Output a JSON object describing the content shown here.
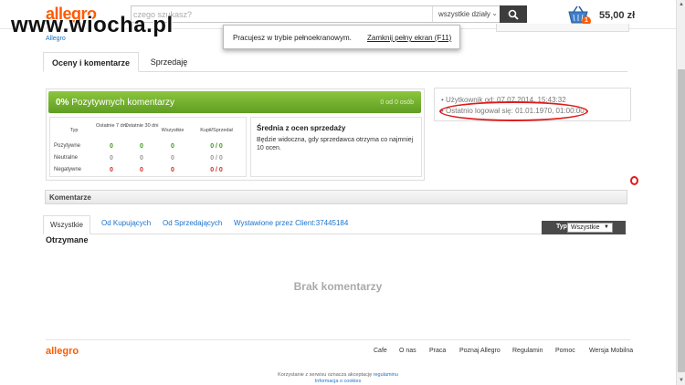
{
  "header": {
    "logo": "allegro",
    "watermark": "www.wiocha.pl",
    "search_placeholder": "czego szukasz?",
    "department": "wszystkie działy",
    "cart_count": "1",
    "cart_total": "55,00 zł"
  },
  "breadcrumb": {
    "brand": "Allegro"
  },
  "fullscreen_notice": {
    "message": "Pracujesz w trybie pełnoekranowym.",
    "exit_link": "Zamknij pełny ekran (F11)"
  },
  "tabs": [
    {
      "label": "Oceny i komentarze"
    },
    {
      "label": "Sprzedaję"
    }
  ],
  "ratings": {
    "percent": "0%",
    "title": "Pozytywnych komentarzy",
    "count_note": "0 od 0 osób",
    "headers": [
      "Typ",
      "Ostatnie 7 dni",
      "Ostatnie 30 dni",
      "Wszystkie",
      "Kupił/Sprzedał"
    ],
    "rows": [
      {
        "label": "Pozytywne",
        "d7": "0",
        "d30": "0",
        "all": "0",
        "ratio": "0 / 0"
      },
      {
        "label": "Neutralne",
        "d7": "0",
        "d30": "0",
        "all": "0",
        "ratio": "0 / 0"
      },
      {
        "label": "Negatywne",
        "d7": "0",
        "d30": "0",
        "all": "0",
        "ratio": "0 / 0"
      }
    ],
    "average_title": "Średnia z ocen sprzedaży",
    "average_text": "Będzie widoczna, gdy sprzedawca otrzyma co najmniej 10 ocen."
  },
  "user_info": {
    "user_since": "• Użytkownik od: 07.07.2014, 15:43:32",
    "last_login": "• Ostatnio logował się: 01.01.1970, 01:00:00"
  },
  "comments": {
    "section_title": "Komentarze",
    "subtabs": [
      {
        "label": "Wszystkie"
      },
      {
        "label": "Od Kupujących"
      },
      {
        "label": "Od Sprzedających"
      },
      {
        "label": "Wystawione przez Client:37445184"
      }
    ],
    "type_label": "Typ",
    "type_value": "Wszystkie",
    "received_heading": "Otrzymane",
    "empty_message": "Brak komentarzy"
  },
  "footer": {
    "logo": "allegro",
    "links": [
      "Cafe",
      "O nas",
      "Praca",
      "Poznaj Allegro",
      "Regulamin",
      "Pomoc",
      "Wersja Mobilna"
    ],
    "cookie_text": "Korzystanie z serwisu oznacza akceptację",
    "cookie_link1": "regulaminu",
    "cookie_link2": "Informacja o cookies"
  },
  "colors": {
    "brand": "#ff5a00",
    "positive": "#3d9a1b",
    "negative": "#d9261c",
    "link": "#1a71c9",
    "annotation": "#e01a1a"
  }
}
